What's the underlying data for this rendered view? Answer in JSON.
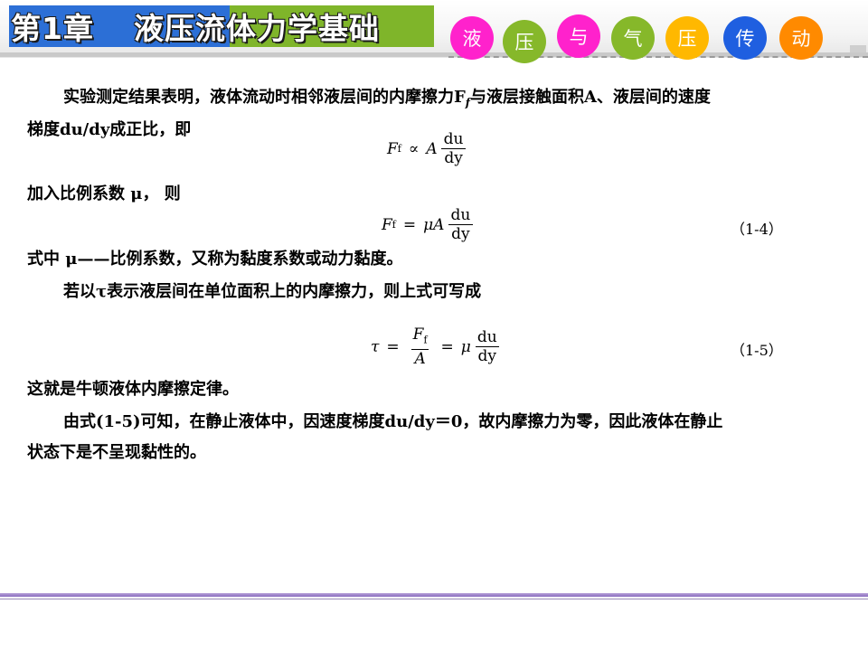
{
  "header": {
    "chapter_number": "第1章",
    "chapter_name": "液压流体力学基础",
    "course_chars": [
      {
        "char": "液",
        "color": "#ff22cc"
      },
      {
        "char": "压",
        "color": "#86b82a"
      },
      {
        "char": "与",
        "color": "#ff22cc"
      },
      {
        "char": "气",
        "color": "#86b82a"
      },
      {
        "char": "压",
        "color": "#ffb800"
      },
      {
        "char": "传",
        "color": "#1f5fe0"
      },
      {
        "char": "动",
        "color": "#ff8a00"
      }
    ]
  },
  "body": {
    "para1_line1": "实验测定结果表明，液体流动时相邻液层间的内摩擦力F",
    "para1_sub": "f",
    "para1_line1_end": "与液层接触面积A、液层间的速度",
    "para1_line2": "梯度du/dy成正比，即",
    "eq1": {
      "lhs": "F",
      "lhs_sub": "f",
      "op": "∝",
      "var": "A",
      "num": "du",
      "den": "dy"
    },
    "line_add": "加入比例系数 μ， 则",
    "eq2": {
      "lhs": "F",
      "lhs_sub": "f",
      "op": "=",
      "var": "μA",
      "num": "du",
      "den": "dy",
      "number": "（1-4）"
    },
    "line_where": "式中 μ——比例系数，又称为黏度系数或动力黏度。",
    "line_tau": "若以τ表示液层间在单位面积上的内摩擦力，则上式可写成",
    "eq3": {
      "lhs": "τ",
      "op": "=",
      "f_num": "F",
      "f_num_sub": "f",
      "f_den": "A",
      "op2": "=",
      "var": "μ",
      "num": "du",
      "den": "dy",
      "number": "（1-5）"
    },
    "line_law": "这就是牛顿液体内摩擦定律。",
    "para_last_line1": "由式(1-5)可知，在静止液体中，因速度梯度du/dy＝0，故内摩擦力为零，因此液体在静止",
    "para_last_line2": "状态下是不呈现黏性的。"
  }
}
